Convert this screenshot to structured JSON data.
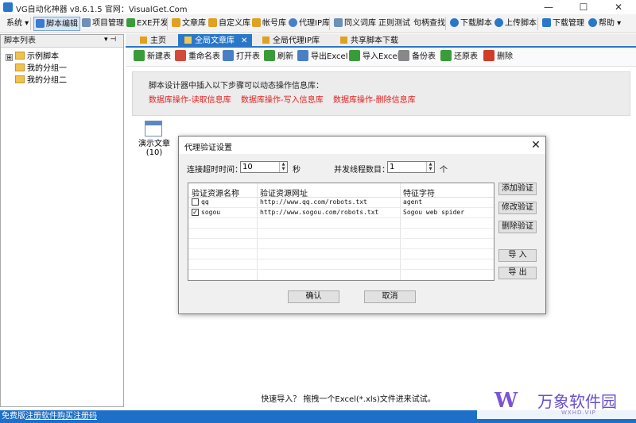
{
  "window": {
    "title": "VG自动化神器 v8.6.1.5    官网：VisualGet.Com",
    "minimize": "—",
    "maximize": "☐",
    "close": "✕"
  },
  "menubar": {
    "items": [
      {
        "label": "系统 ▾"
      },
      {
        "label": "脚本编辑",
        "icon": "script-edit-icon",
        "color": "#3b7bd1"
      },
      {
        "label": "项目管理",
        "icon": "project-icon",
        "color": "#6d8fb8"
      },
      {
        "label": "EXE开发",
        "icon": "exe-icon",
        "color": "#3a9b3a"
      },
      {
        "label": "文章库",
        "icon": "article-lib-icon",
        "color": "#e0a020"
      },
      {
        "label": "自定义库",
        "icon": "custom-lib-icon",
        "color": "#e0a020"
      },
      {
        "label": "帐号库",
        "icon": "account-lib-icon",
        "color": "#e0a020"
      },
      {
        "label": "代理IP库",
        "icon": "proxy-ip-icon",
        "color": "#4a7fc8"
      },
      {
        "label": "同义词库",
        "icon": "synonym-icon",
        "color": "#6d8fb8"
      },
      {
        "label": "正则测试"
      },
      {
        "label": "句柄查找"
      },
      {
        "label": "下载脚本",
        "icon": "cloud-download-icon",
        "color": "#2a77c9"
      },
      {
        "label": "上传脚本",
        "icon": "cloud-upload-icon",
        "color": "#2a77c9"
      },
      {
        "label": "下载管理",
        "icon": "download-manager-icon",
        "color": "#2a77c9"
      },
      {
        "label": "帮助 ▾",
        "icon": "help-icon",
        "color": "#2a77c9"
      }
    ]
  },
  "sidebar": {
    "header": "脚本列表",
    "pin": "▾ ⊣",
    "items": [
      {
        "label": "示例脚本",
        "expander": "⊞"
      },
      {
        "label": "我的分组一"
      },
      {
        "label": "我的分组二"
      }
    ]
  },
  "tabs": [
    {
      "label": "主页",
      "active": false
    },
    {
      "label": "全局文章库",
      "active": true,
      "close": "✕"
    },
    {
      "label": "全局代理IP库",
      "active": false
    },
    {
      "label": "共享脚本下载",
      "active": false
    }
  ],
  "content_toolbar": [
    {
      "label": "新建表",
      "icon": "new-table-icon",
      "color": "#3a9b3a"
    },
    {
      "label": "重命名表",
      "icon": "rename-table-icon",
      "color": "#d24a3a"
    },
    {
      "label": "打开表",
      "icon": "open-table-icon",
      "color": "#4a7fc8"
    },
    {
      "label": "刷新",
      "icon": "refresh-icon",
      "color": "#3a9b3a"
    },
    {
      "label": "导出Excel",
      "icon": "export-excel-icon",
      "color": "#4a7fc8"
    },
    {
      "label": "导入Excel",
      "icon": "import-excel-icon",
      "color": "#3a9b3a"
    },
    {
      "label": "备份表",
      "icon": "backup-table-icon",
      "color": "#888888"
    },
    {
      "label": "还原表",
      "icon": "restore-table-icon",
      "color": "#3a9b3a"
    },
    {
      "label": "删除",
      "icon": "delete-icon",
      "color": "#d23a2a"
    }
  ],
  "info_panel": {
    "intro": "脚本设计器中插入以下步骤可以动态操作信息库：",
    "links": [
      "数据库操作-读取信息库",
      "数据库操作-写入信息库",
      "数据库操作-删除信息库"
    ]
  },
  "content": {
    "table_name": "演示文章",
    "table_count": "(10)"
  },
  "bottom_hint": "快速导入？ 拖拽一个Excel(*.xls)文件进来试试。",
  "statusbar": {
    "edition": "免费版",
    "register": "注册软件",
    "buy": "购买注册码"
  },
  "watermark": {
    "logo": "W",
    "name": "万象软件园",
    "url": "WXHD.VIP"
  },
  "dialog": {
    "title": "代理验证设置",
    "close": "✕",
    "timeout_label": "连接超时时间：",
    "timeout_value": "10",
    "timeout_unit": "秒",
    "threads_label": "并发线程数目：",
    "threads_value": "1",
    "threads_unit": "个",
    "columns": [
      "验证资源名称",
      "验证资源网址",
      "特征字符"
    ],
    "rows": [
      {
        "checked": false,
        "name": "qq",
        "url": "http://www.qq.com/robots.txt",
        "feature": "agent"
      },
      {
        "checked": true,
        "name": "sogou",
        "url": "http://www.sogou.com/robots.txt",
        "feature": "Sogou web spider"
      }
    ],
    "side_buttons": [
      "添加验证",
      "修改验证",
      "删除验证",
      "导  入",
      "导  出"
    ],
    "ok": "确认",
    "cancel": "取消"
  }
}
